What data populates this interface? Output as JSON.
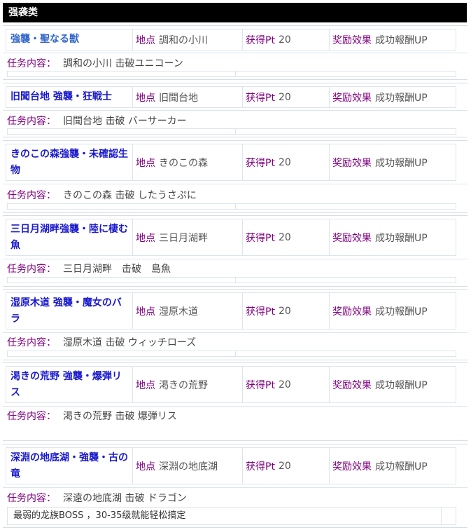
{
  "section_title": "强袭类",
  "labels": {
    "location": "地点",
    "points": "获得Pt",
    "reward": "奖励效果",
    "task": "任务内容："
  },
  "colors": {
    "name": "#1a1acc",
    "label": "#800080",
    "title_bg": "#000000"
  },
  "quests": [
    {
      "name": "強襲・聖なる獣",
      "location": "調和の小川",
      "points": "20",
      "reward": "成功報酬UP",
      "task": "調和の小川 击破ユニコーン"
    },
    {
      "name": "旧聞台地 強襲・狂戦士",
      "location": "旧聞台地",
      "points": "20",
      "reward": "成功報酬UP",
      "task": "旧聞台地 击破 バーサーカー"
    },
    {
      "name": "きのこの森強襲・未確認生物",
      "location": "きのこの森",
      "points": "20",
      "reward": "成功報酬UP",
      "task": "きのこの森 击破 したうさぷに"
    },
    {
      "name": "三日月湖畔強襲・陸に棲む魚",
      "location": "三日月湖畔",
      "points": "20",
      "reward": "成功報酬UP",
      "task": "三日月湖畔　击破　島魚"
    },
    {
      "name": "湿原木道 強襲・魔女のバラ",
      "location": "湿原木道",
      "points": "20",
      "reward": "成功報酬UP",
      "task": "湿原木道 击破 ウィッチローズ"
    },
    {
      "name": "渇きの荒野 強襲・爆弾リス",
      "location": "渇きの荒野",
      "points": "20",
      "reward": "成功報酬UP",
      "task": "渇きの荒野 击破 爆弾リス"
    },
    {
      "name": "深淵の地底湖・強襲・古の竜",
      "location": "深淵の地底湖",
      "points": "20",
      "reward": "成功報酬UP",
      "task": "深遠の地底湖 击破 ドラゴン",
      "note": "最弱的龙族BOSS ，30-35级就能轻松搞定"
    }
  ]
}
